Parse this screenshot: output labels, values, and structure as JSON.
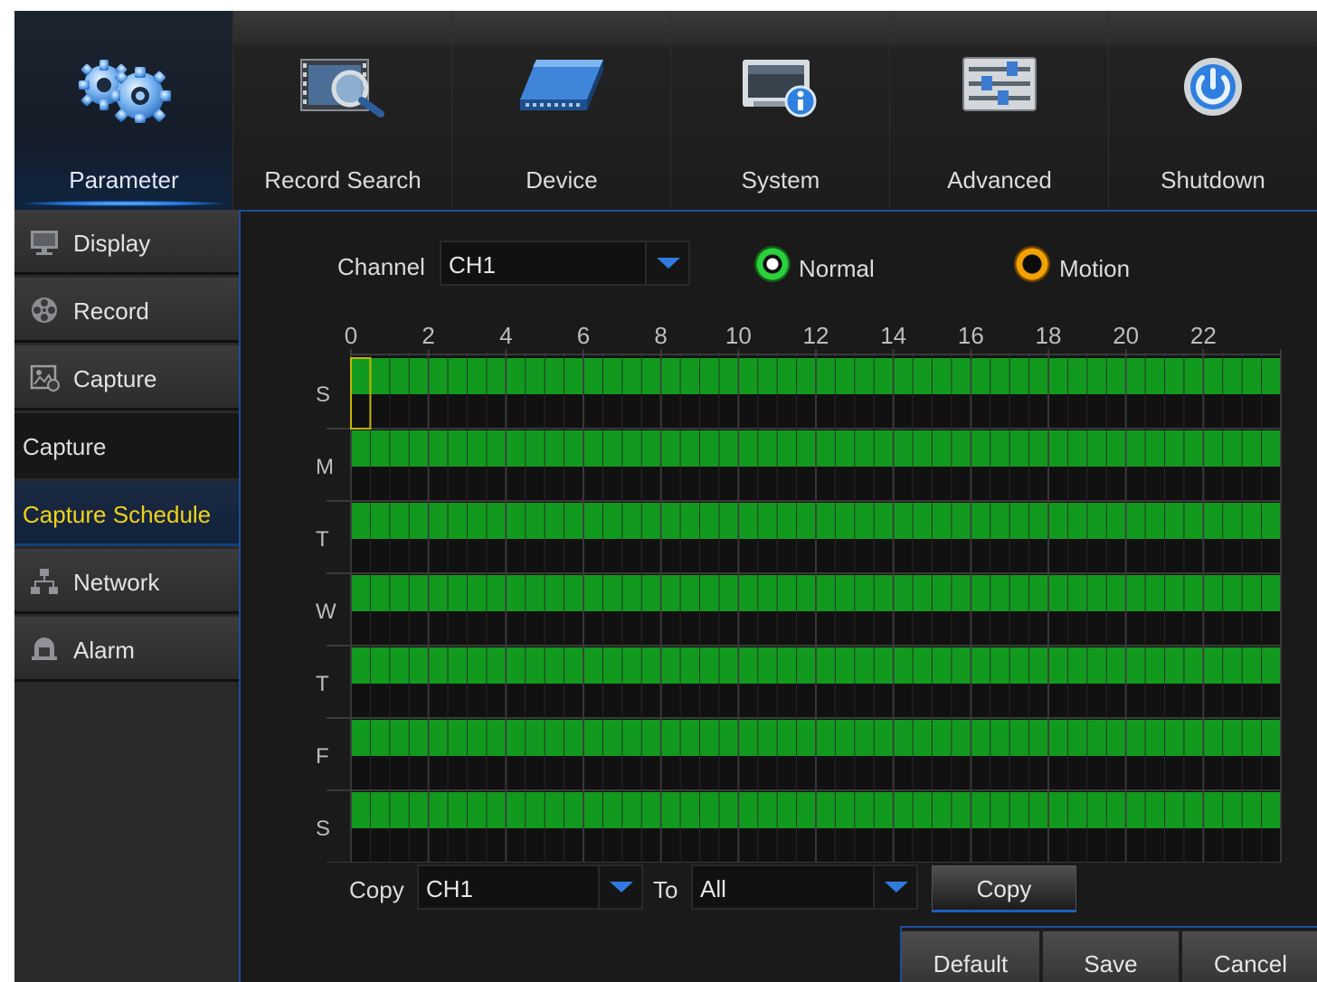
{
  "nav": {
    "items": [
      {
        "label": "Parameter",
        "icon": "gears-icon",
        "active": true
      },
      {
        "label": "Record Search",
        "icon": "film-magnifier-icon",
        "active": false
      },
      {
        "label": "Device",
        "icon": "hard-drive-icon",
        "active": false
      },
      {
        "label": "System",
        "icon": "system-info-icon",
        "active": false
      },
      {
        "label": "Advanced",
        "icon": "sliders-icon",
        "active": false
      },
      {
        "label": "Shutdown",
        "icon": "power-icon",
        "active": false
      }
    ]
  },
  "sidebar": {
    "display": "Display",
    "record": "Record",
    "capture": "Capture",
    "capture_sub": "Capture",
    "capture_schedule": "Capture Schedule",
    "network": "Network",
    "alarm": "Alarm"
  },
  "schedule": {
    "channel_label": "Channel",
    "channel_value": "CH1",
    "legend_normal": "Normal",
    "legend_motion": "Motion",
    "hour_labels": [
      "0",
      "2",
      "4",
      "6",
      "8",
      "10",
      "12",
      "14",
      "16",
      "18",
      "20",
      "22"
    ],
    "days": [
      "S",
      "M",
      "T",
      "W",
      "T",
      "F",
      "S"
    ],
    "normal_color": "#129a1f",
    "selection_color": "#c8b400"
  },
  "copy": {
    "label": "Copy",
    "from_value": "CH1",
    "to_label": "To",
    "to_value": "All",
    "button": "Copy"
  },
  "footer": {
    "default": "Default",
    "save": "Save",
    "cancel": "Cancel"
  }
}
